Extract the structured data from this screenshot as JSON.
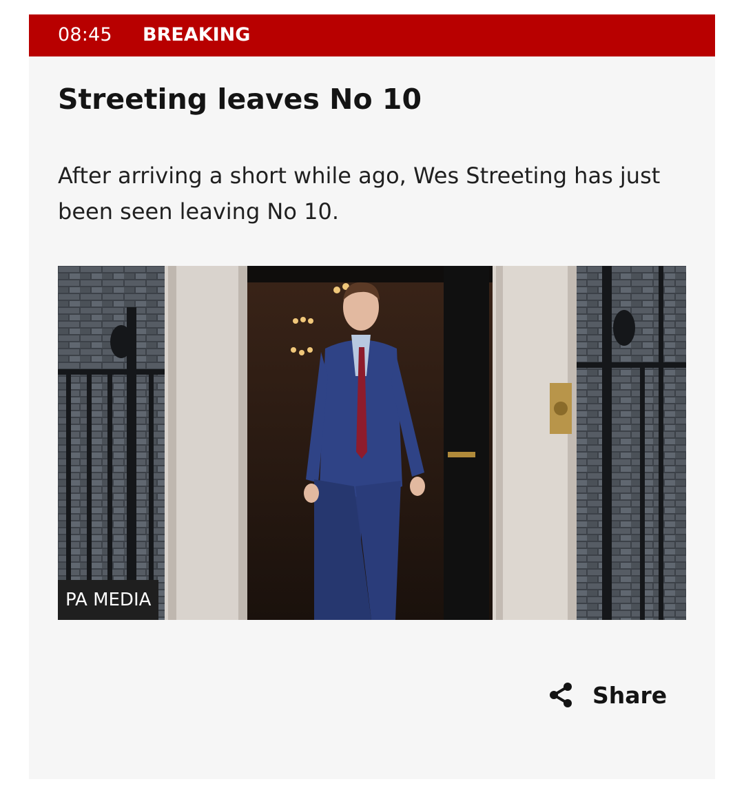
{
  "post": {
    "time": "08:45",
    "tag": "BREAKING",
    "headline": "Streeting leaves No 10",
    "body": "After arriving a short while ago, Wes Streeting has just been seen leaving No 10.",
    "image": {
      "credit": "PA MEDIA"
    },
    "share_label": "Share"
  },
  "colors": {
    "breaking_bar": "#b80000",
    "card_background": "#f6f6f6",
    "text": "#141414"
  },
  "icons": {
    "share": "share-icon"
  }
}
